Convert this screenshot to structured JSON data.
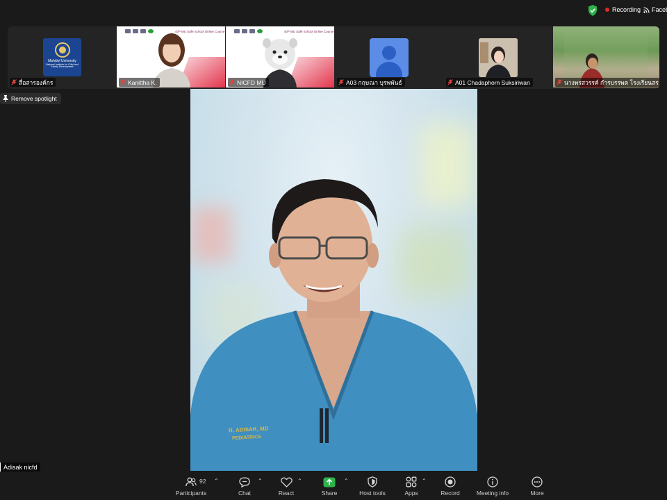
{
  "status_bar": {
    "recording_label": "Recording",
    "live_label": "Faceb"
  },
  "participants_strip": [
    {
      "name": "สื่อสารองค์กร",
      "type": "logo",
      "logo_title": "Mahidol University",
      "logo_subtitle": "National Institute for Child and Family Development"
    },
    {
      "name": "Kanittha K.",
      "type": "camera",
      "slide_title": "40ᵗʰ MU Safe School Online Course"
    },
    {
      "name": "NICFD MU",
      "type": "camera",
      "slide_title": "40ᵗʰ MU Safe School Online Course"
    },
    {
      "name": "A03 กฤษณา บุรพพันธ์",
      "type": "avatar"
    },
    {
      "name": "A01 Chadaphorn Suksiriwan",
      "type": "photo"
    },
    {
      "name": "นางพรสวรรค์ กำรบรรพต  โรงเรียนสร...",
      "type": "camera"
    }
  ],
  "spotlight": {
    "remove_label": "Remove spotlight"
  },
  "main_speaker": {
    "name": "Adisak nicfd",
    "scrub_text_1": "R. ADISAK, MD",
    "scrub_text_2": "PEDIATRICS"
  },
  "toolbar": {
    "participants_label": "Participants",
    "participants_count": "92",
    "chat_label": "Chat",
    "react_label": "React",
    "share_label": "Share",
    "host_tools_label": "Host tools",
    "apps_label": "Apps",
    "record_label": "Record",
    "meeting_info_label": "Meeting info",
    "more_label": "More"
  },
  "colors": {
    "background": "#1a1a1a",
    "share_green": "#2db34a",
    "recording_red": "#e02828",
    "shield_green": "#2db34a",
    "mic_off_red": "#e0443a",
    "scrubs_blue": "#3f8fc0"
  }
}
